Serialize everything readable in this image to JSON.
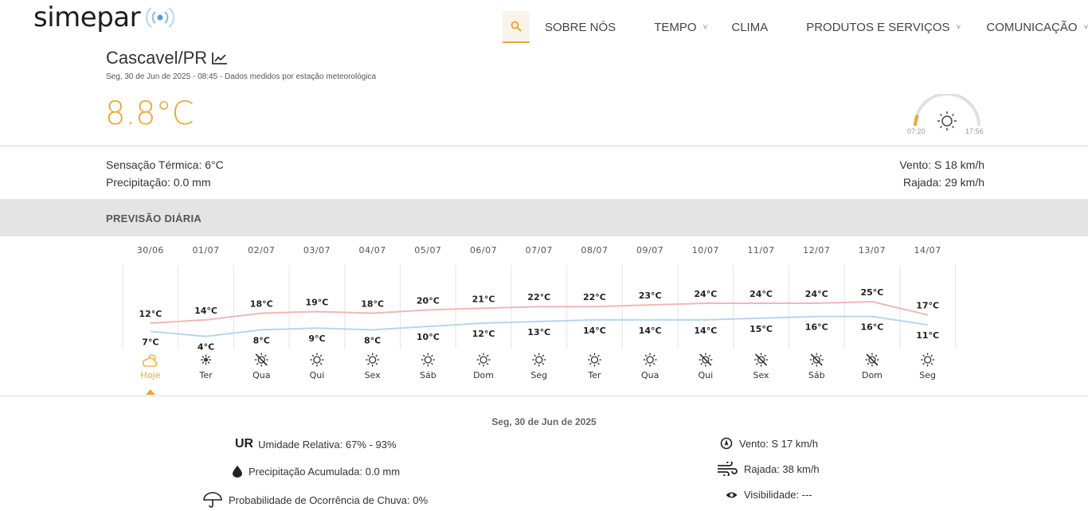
{
  "brand": {
    "logo_text": "simepar"
  },
  "nav": {
    "items": [
      {
        "label": "SOBRE NÓS",
        "dropdown": false
      },
      {
        "label": "TEMPO",
        "dropdown": true
      },
      {
        "label": "CLIMA",
        "dropdown": false
      },
      {
        "label": "PRODUTOS E SERVIÇOS",
        "dropdown": true
      },
      {
        "label": "COMUNICAÇÃO",
        "dropdown": true
      }
    ]
  },
  "current": {
    "city": "Cascavel/PR",
    "measured_at": "Seg, 30 de Jun de 2025 - 08:45 - Dados medidos por estação meteorológica",
    "temperature": "8.8°C",
    "sunrise": "07:20",
    "sunset": "17:56",
    "feels_like": "Sensação Térmica: 6°C",
    "precipitation": "Precipitação: 0.0 mm",
    "wind": "Vento: S 18 km/h",
    "gust": "Rajada: 29 km/h"
  },
  "forecast": {
    "title": "PREVISÃO DIÁRIA",
    "colors": {
      "max_line": "#f4b6b6",
      "min_line": "#b6d6ee",
      "accent": "#e8a838"
    },
    "days": [
      {
        "date": "30/06",
        "day": "Hoje",
        "max": 12,
        "min": 7,
        "max_label": "12°C",
        "min_label": "7°C",
        "icon": "partly-cloudy-icon"
      },
      {
        "date": "01/07",
        "day": "Ter",
        "max": 14,
        "min": 4,
        "max_label": "14°C",
        "min_label": "4°C",
        "icon": "clear-night-icon"
      },
      {
        "date": "02/07",
        "day": "Qua",
        "max": 18,
        "min": 8,
        "max_label": "18°C",
        "min_label": "8°C",
        "icon": "sun-cloud-icon"
      },
      {
        "date": "03/07",
        "day": "Qui",
        "max": 19,
        "min": 9,
        "max_label": "19°C",
        "min_label": "9°C",
        "icon": "sun-icon"
      },
      {
        "date": "04/07",
        "day": "Sex",
        "max": 18,
        "min": 8,
        "max_label": "18°C",
        "min_label": "8°C",
        "icon": "sun-icon"
      },
      {
        "date": "05/07",
        "day": "Sáb",
        "max": 20,
        "min": 10,
        "max_label": "20°C",
        "min_label": "10°C",
        "icon": "sun-icon"
      },
      {
        "date": "06/07",
        "day": "Dom",
        "max": 21,
        "min": 12,
        "max_label": "21°C",
        "min_label": "12°C",
        "icon": "sun-icon"
      },
      {
        "date": "07/07",
        "day": "Seg",
        "max": 22,
        "min": 13,
        "max_label": "22°C",
        "min_label": "13°C",
        "icon": "sun-icon"
      },
      {
        "date": "08/07",
        "day": "Ter",
        "max": 22,
        "min": 14,
        "max_label": "22°C",
        "min_label": "14°C",
        "icon": "sun-icon"
      },
      {
        "date": "09/07",
        "day": "Qua",
        "max": 23,
        "min": 14,
        "max_label": "23°C",
        "min_label": "14°C",
        "icon": "sun-icon"
      },
      {
        "date": "10/07",
        "day": "Qui",
        "max": 24,
        "min": 14,
        "max_label": "24°C",
        "min_label": "14°C",
        "icon": "sun-cloud-icon"
      },
      {
        "date": "11/07",
        "day": "Sex",
        "max": 24,
        "min": 15,
        "max_label": "24°C",
        "min_label": "15°C",
        "icon": "sun-cloud-icon"
      },
      {
        "date": "12/07",
        "day": "Sáb",
        "max": 24,
        "min": 16,
        "max_label": "24°C",
        "min_label": "16°C",
        "icon": "sun-cloud-icon"
      },
      {
        "date": "13/07",
        "day": "Dom",
        "max": 25,
        "min": 16,
        "max_label": "25°C",
        "min_label": "16°C",
        "icon": "sun-cloud-icon"
      },
      {
        "date": "14/07",
        "day": "Seg",
        "max": 17,
        "min": 11,
        "max_label": "17°C",
        "min_label": "11°C",
        "icon": "sun-icon"
      }
    ]
  },
  "details": {
    "date": "Seg, 30 de Jun de 2025",
    "ur_tag": "UR",
    "humidity": "Umidade Relativa: 67% - 93%",
    "precipitation": "Precipitação Acumulada: 0.0 mm",
    "rain_probability": "Probabilidade de Ocorrência de Chuva: 0%",
    "wind": "Vento: S 17 km/h",
    "gust": "Rajada: 38 km/h",
    "visibility": "Visibilidade: ---"
  }
}
